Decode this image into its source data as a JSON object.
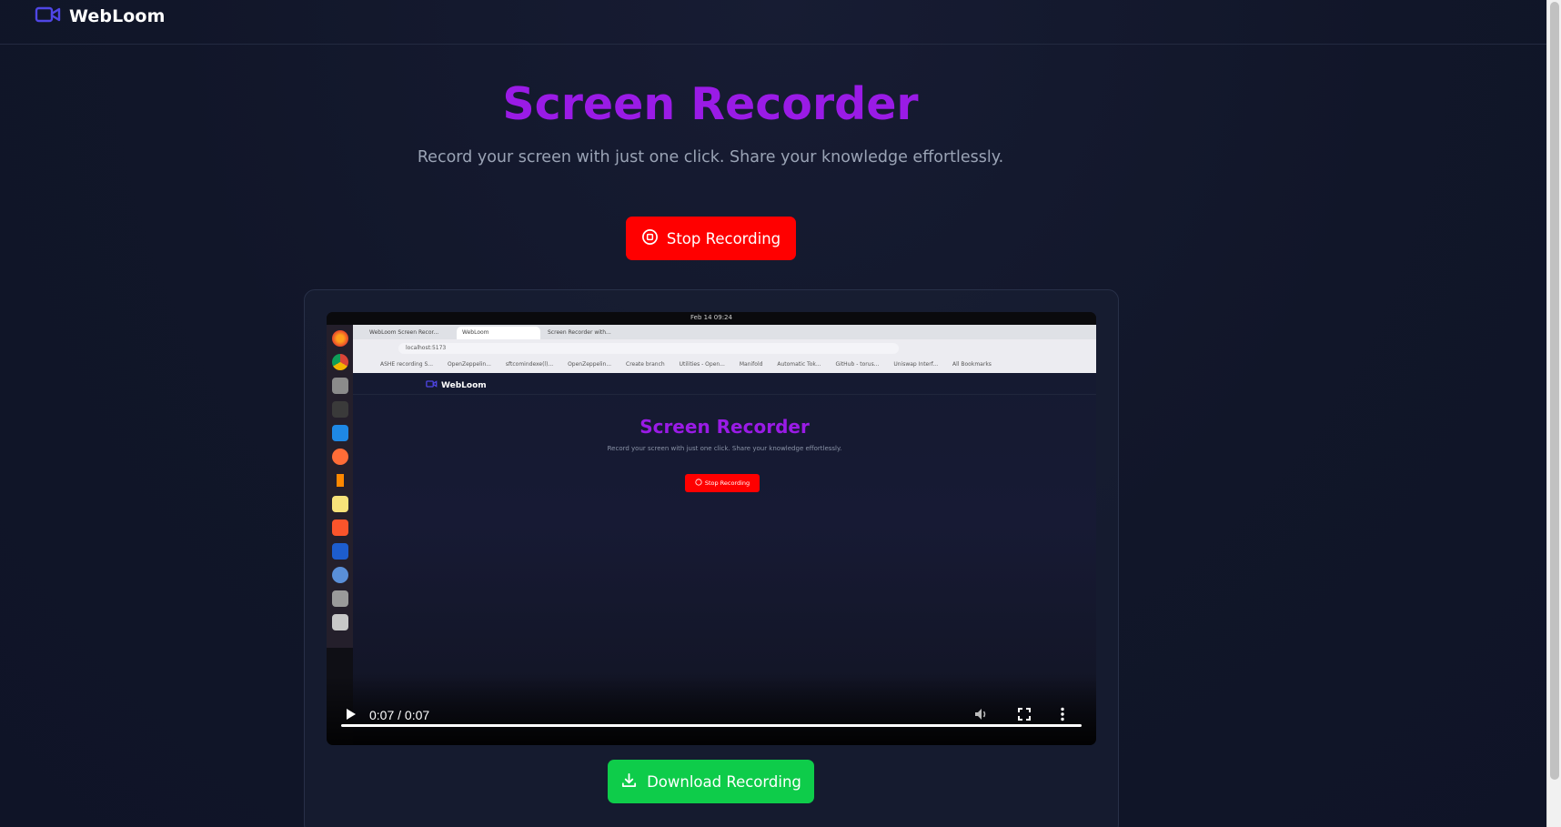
{
  "brand": {
    "name": "WebLoom",
    "icon": "video-camera-icon",
    "color": "#4f46e5"
  },
  "hero": {
    "title": "Screen Recorder",
    "subtitle": "Record your screen with just one click. Share your knowledge effortlessly."
  },
  "actions": {
    "stop_label": "Stop Recording",
    "stop_icon": "stop-circle-icon",
    "download_label": "Download Recording",
    "download_icon": "download-icon"
  },
  "player": {
    "time": "0:07 / 0:07",
    "progress": 1.0,
    "controls": [
      "play-icon",
      "volume-icon",
      "fullscreen-icon",
      "more-options-icon"
    ]
  },
  "recording_preview": {
    "clock": "Feb 14 09:24",
    "tabs": [
      "WebLoom Screen Recor...",
      "WebLoom",
      "Screen Recorder with..."
    ],
    "url": "localhost:5173",
    "bookmarks": [
      "ASHE recording S...",
      "OpenZeppelin...",
      "sftcomindexe(l)...",
      "OpenZeppelin...",
      "Create branch",
      "Utilities - Open...",
      "Manifold",
      "Automatic Tok...",
      "GitHub - torus...",
      "Uniswap Interf..."
    ],
    "bookmarks_folder": "All Bookmarks",
    "brand": "WebLoom",
    "title": "Screen Recorder",
    "subtitle": "Record your screen with just one click. Share your knowledge effortlessly.",
    "stop_label": "Stop Recording"
  },
  "colors": {
    "title": "#9a1be6",
    "stop": "#ff0000",
    "download": "#0ecc4a",
    "background": "#111629"
  }
}
